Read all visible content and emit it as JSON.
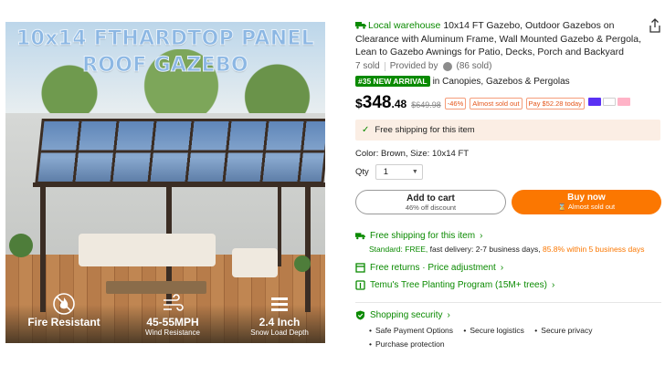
{
  "image": {
    "headline_line1": "10x14 FTHARDTOP PANEL",
    "headline_line2": "ROOF GAZEBO",
    "features": [
      {
        "title": "Fire Resistant",
        "subtitle": "",
        "icon": "flame-icon"
      },
      {
        "title": "45-55MPH",
        "subtitle": "Wind Resistance",
        "icon": "wind-icon"
      },
      {
        "title": "2.4 Inch",
        "subtitle": "Snow Load Depth",
        "icon": "layers-icon"
      }
    ]
  },
  "product": {
    "warehouse_label": "Local warehouse",
    "title": "10x14 FT Gazebo, Outdoor Gazebos on Clearance with Aluminum Frame, Wall Mounted Gazebo & Pergola, Lean to Gazebo Awnings for Patio, Decks, Porch and Backyard",
    "sold": "7 sold",
    "provided_by": "Provided by",
    "provider_count": "(86 sold)",
    "rank_badge": "#35 NEW ARRIVAL",
    "rank_text": "in Canopies, Gazebos & Pergolas",
    "price_currency": "$",
    "price_int": "348",
    "price_dec": ".48",
    "original_price": "$649.98",
    "discount_tag": "-46%",
    "stock_tag": "Almost sold out",
    "pay_tag": "Pay $52.28 today"
  },
  "shipping_box": {
    "text": "Free shipping for this item"
  },
  "options": {
    "color_size": "Color: Brown, Size: 10x14 FT",
    "qty_label": "Qty",
    "qty_value": "1"
  },
  "buttons": {
    "cart_label": "Add to cart",
    "cart_sub": "46% off discount",
    "buy_label": "Buy now",
    "buy_sub": "Almost sold out"
  },
  "benefits": {
    "shipping_label": "Free shipping for this item",
    "standard_prefix": "Standard:",
    "standard_free": "FREE,",
    "standard_delivery": "fast delivery: 2-7 business days,",
    "standard_rate": "85.8% within 5 business days",
    "returns_label": "Free returns · Price adjustment",
    "tree_label": "Temu's Tree Planting Program (15M+ trees)",
    "security_label": "Shopping security",
    "security_items": [
      "Safe Payment Options",
      "Secure logistics",
      "Secure privacy",
      "Purchase protection"
    ]
  },
  "colors": {
    "accent_orange": "#fb7701",
    "green": "#0a8a00",
    "ship_box_bg": "#fbeee4"
  }
}
